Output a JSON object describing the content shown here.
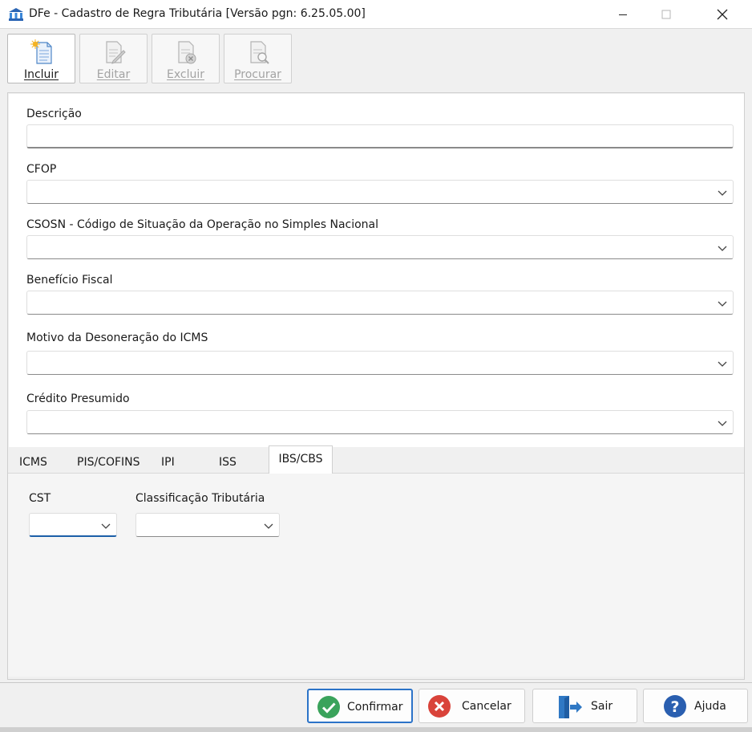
{
  "window": {
    "title": "DFe - Cadastro de Regra Tributária [Versão pgn: 6.25.05.00]",
    "controls": [
      "minimize",
      "maximize",
      "close"
    ]
  },
  "toolbar": {
    "items": [
      {
        "label": "Incluir",
        "icon": "new-document-icon",
        "state": "enabled"
      },
      {
        "label": "Editar",
        "icon": "edit-document-icon",
        "state": "disabled"
      },
      {
        "label": "Excluir",
        "icon": "delete-document-icon",
        "state": "disabled"
      },
      {
        "label": "Procurar",
        "icon": "search-document-icon",
        "state": "disabled"
      }
    ]
  },
  "form": {
    "descricao": {
      "label": "Descrição",
      "value": ""
    },
    "cfop": {
      "label": "CFOP",
      "value": ""
    },
    "csosn": {
      "label": "CSOSN - Código de Situação da Operação no Simples Nacional",
      "value": ""
    },
    "beneficio": {
      "label": "Benefício Fiscal",
      "value": ""
    },
    "motivo": {
      "label": "Motivo da Desoneração do ICMS",
      "value": ""
    },
    "credito": {
      "label": "Crédito Presumido",
      "value": ""
    }
  },
  "tabs": {
    "items": [
      "ICMS",
      "PIS/COFINS",
      "IPI",
      "ISS",
      "IBS/CBS"
    ],
    "active": "IBS/CBS"
  },
  "ibs_cbs": {
    "cst": {
      "label": "CST",
      "value": ""
    },
    "classificacao": {
      "label": "Classificação Tributária",
      "value": ""
    }
  },
  "buttons": {
    "confirmar": {
      "label": "Confirmar",
      "icon": "check-circle-icon",
      "color": "#3aa35b"
    },
    "cancelar": {
      "label": "Cancelar",
      "icon": "x-circle-icon",
      "color": "#d9433a"
    },
    "sair": {
      "label": "Sair",
      "icon": "exit-door-icon",
      "color": "#2f78c4"
    },
    "ajuda": {
      "label": "Ajuda",
      "icon": "help-circle-icon",
      "color": "#2a5fb0"
    }
  }
}
